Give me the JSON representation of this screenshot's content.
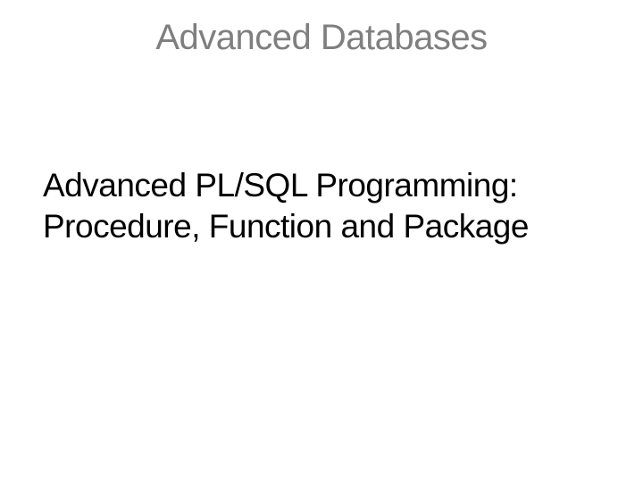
{
  "slide": {
    "title": "Advanced Databases",
    "subtitle": "Advanced PL/SQL Programming:\nProcedure, Function and Package"
  }
}
